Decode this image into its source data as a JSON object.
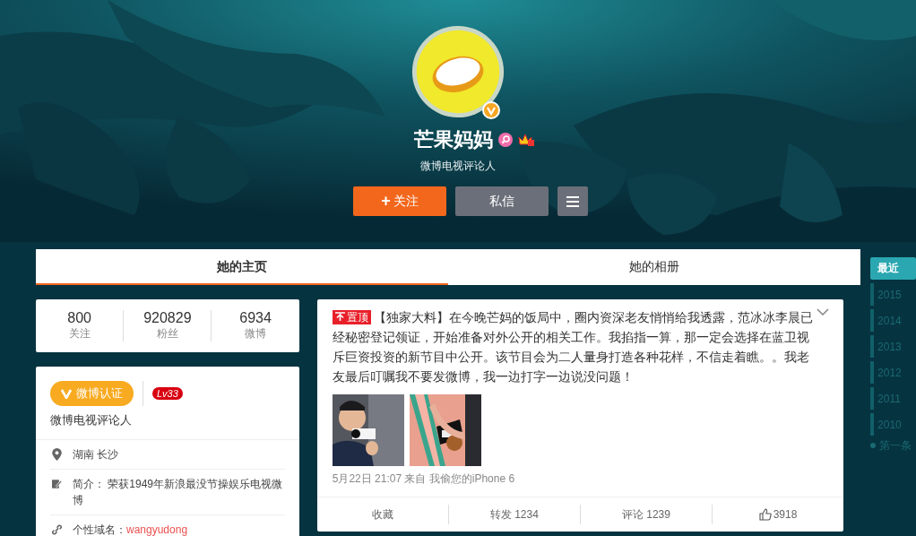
{
  "profile": {
    "name": "芒果妈妈",
    "subtitle": "微博电视评论人",
    "verified": true,
    "buttons": [
      {
        "kind": "follow",
        "label": "关注",
        "icon": "+"
      },
      {
        "kind": "message",
        "label": "私信"
      },
      {
        "kind": "menu"
      }
    ]
  },
  "tabs": [
    {
      "label": "她的主页",
      "selected": true
    },
    {
      "label": "她的相册",
      "selected": false
    }
  ],
  "stats": [
    {
      "value": "800",
      "label": "关注"
    },
    {
      "value": "920829",
      "label": "粉丝"
    },
    {
      "value": "6934",
      "label": "微博"
    }
  ],
  "info": {
    "badge": "微博认证",
    "level": "Lv33",
    "description": "微博电视评论人",
    "items": [
      {
        "kind": "location",
        "text": "湖南 长沙"
      },
      {
        "kind": "bio",
        "text": "简介： 荣获1949年新浪最没节操娱乐电视微博"
      },
      {
        "kind": "domain",
        "label": "个性域名：",
        "link": "wangyudong"
      }
    ]
  },
  "post": {
    "pinned_label": "置顶",
    "text": "【独家大料】在今晚芒妈的饭局中，圈内资深老友悄悄给我透露，范冰冰李晨已经秘密登记领证，开始准备对外公开的相关工作。我掐指一算，那一定会选择在蓝卫视斥巨资投资的新节目中公开。该节目会为二人量身打造各种花样，不信走着瞧。。我老友最后叮嘱我不要发微博，我一边打字一边说没问题！",
    "meta": "5月22日 21:07 来自 我偷您的iPhone 6",
    "actions": [
      {
        "kind": "favorite",
        "label": "收藏"
      },
      {
        "kind": "repost",
        "label": "转发 1234"
      },
      {
        "kind": "comment",
        "label": "评论 1239"
      },
      {
        "kind": "like",
        "label": "3918"
      }
    ]
  },
  "timeline": [
    {
      "label": "最近",
      "selected": true
    },
    {
      "label": "2015",
      "selected": false
    },
    {
      "label": "2014",
      "selected": false
    },
    {
      "label": "2013",
      "selected": false
    },
    {
      "label": "2012",
      "selected": false
    },
    {
      "label": "2011",
      "selected": false
    },
    {
      "label": "2010",
      "selected": false
    },
    {
      "label": "第一条",
      "selected": false
    }
  ]
}
